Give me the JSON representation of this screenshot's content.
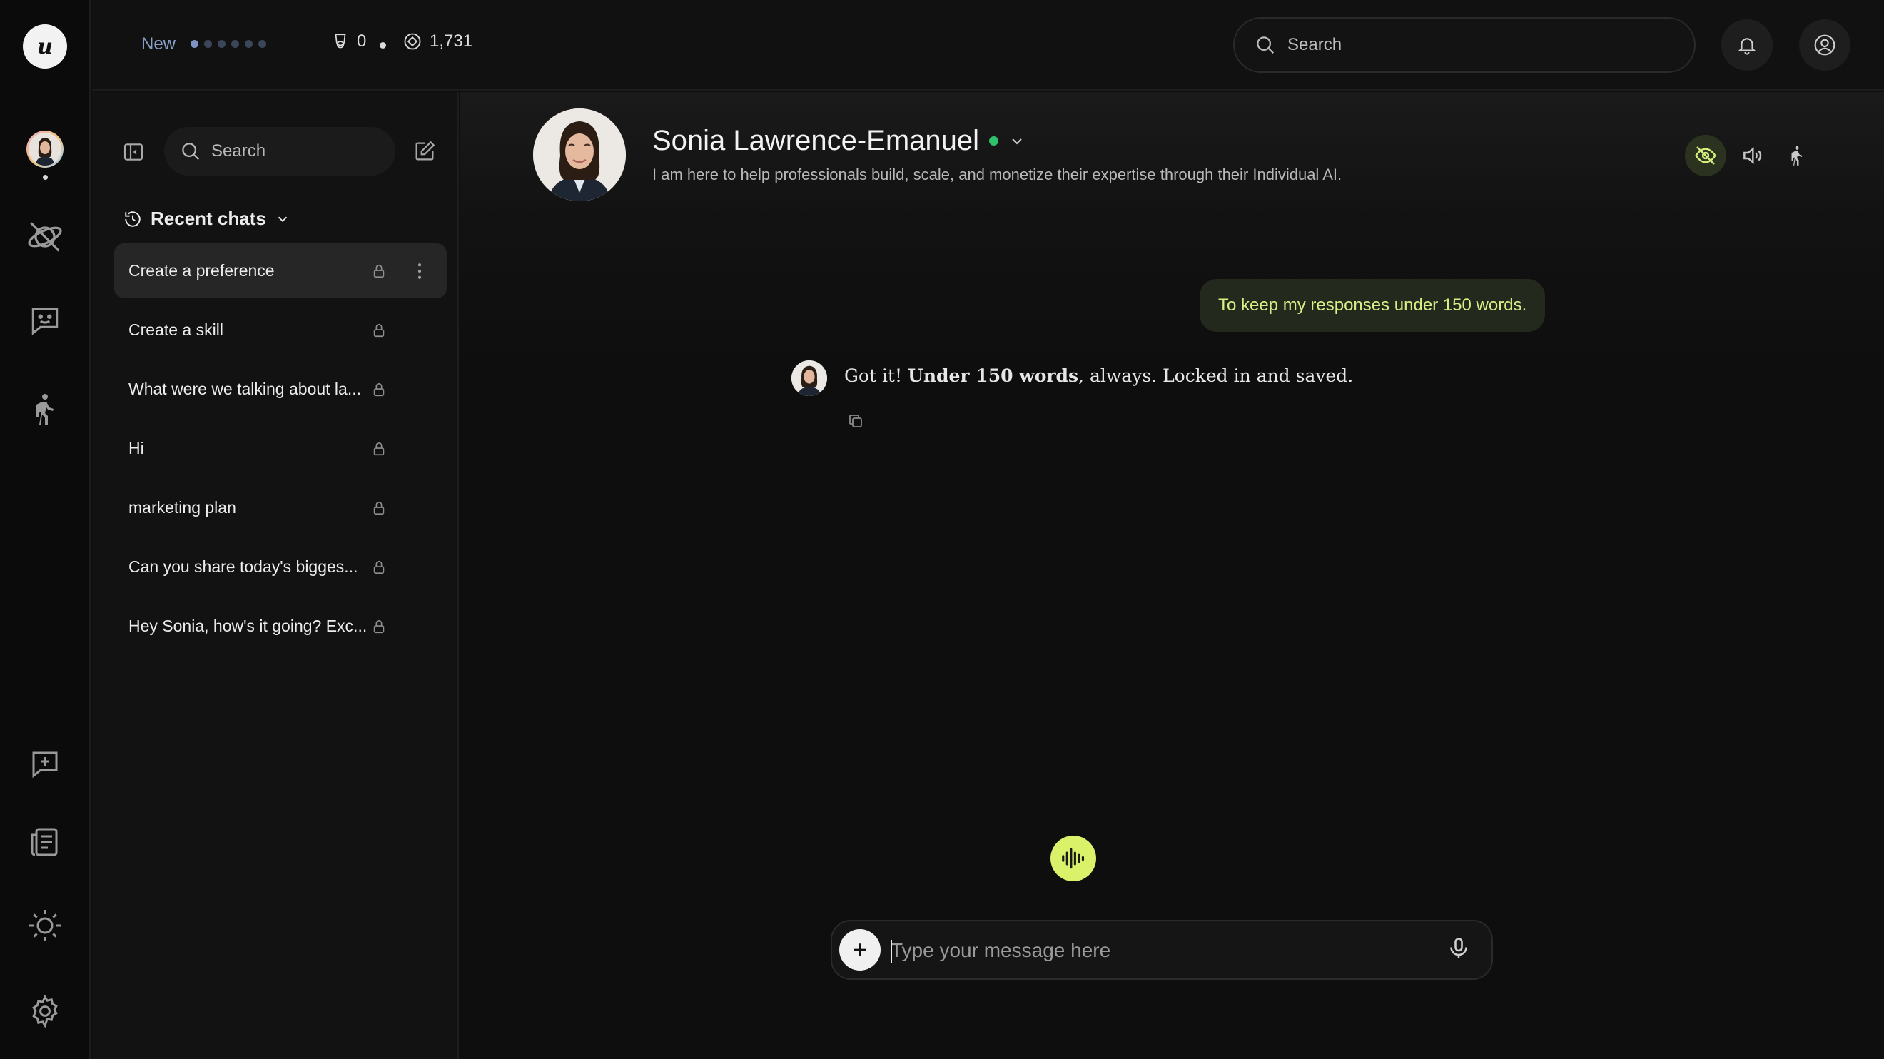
{
  "rail": {
    "logo_text": "u",
    "icons": [
      "planet-off-icon",
      "chat-smile-icon",
      "walk-icon",
      "message-plus-icon",
      "news-icon",
      "sun-icon",
      "gear-icon"
    ]
  },
  "topbar": {
    "new_label": "New",
    "stat_one": "0",
    "stat_two": "1,731",
    "search_placeholder": "Search"
  },
  "sidebar": {
    "search_placeholder": "Search",
    "recent_label": "Recent chats",
    "chats": [
      {
        "title": "Create a preference",
        "active": true
      },
      {
        "title": "Create a skill"
      },
      {
        "title": "What were we talking about la..."
      },
      {
        "title": "Hi"
      },
      {
        "title": "marketing plan"
      },
      {
        "title": "Can you share today's bigges..."
      },
      {
        "title": "Hey Sonia, how's it going? Exc..."
      }
    ]
  },
  "profile": {
    "name": "Sonia Lawrence-Emanuel",
    "bio": "I am here to help professionals build, scale, and monetize their expertise through their Individual AI.",
    "status_color": "#2fc06b"
  },
  "conversation": {
    "user_message": "To keep my responses under 150 words.",
    "bot_message_prefix": "Got it! ",
    "bot_message_bold": "Under 150 words",
    "bot_message_suffix": ", always. Locked in and saved."
  },
  "composer": {
    "placeholder": "Type your message here"
  },
  "colors": {
    "accent": "#d9f26a",
    "user_bubble_bg": "#23291c",
    "user_bubble_text": "#d8ef86"
  }
}
